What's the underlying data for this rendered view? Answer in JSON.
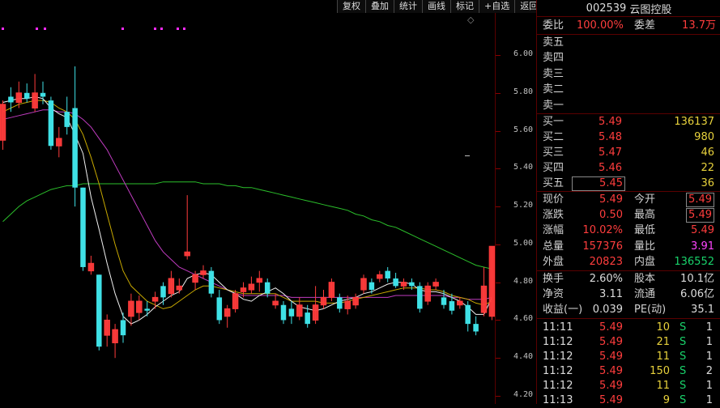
{
  "toolbar": {
    "buttons": [
      "复权",
      "叠加",
      "统计",
      "画线",
      "标记",
      "+自选",
      "返回"
    ]
  },
  "chart_data": {
    "type": "candlestick",
    "yticks": [
      "6.00",
      "5.80",
      "5.60",
      "5.40",
      "5.20",
      "5.00",
      "4.80",
      "4.60",
      "4.40",
      "4.20"
    ],
    "ylim": [
      4.2,
      6.0
    ],
    "candles": [
      {
        "o": 5.55,
        "c": 5.74,
        "h": 5.76,
        "l": 5.5
      },
      {
        "o": 5.78,
        "c": 5.75,
        "h": 5.83,
        "l": 5.7
      },
      {
        "o": 5.75,
        "c": 5.8,
        "h": 5.86,
        "l": 5.72
      },
      {
        "o": 5.8,
        "c": 5.77,
        "h": 5.85,
        "l": 5.75
      },
      {
        "o": 5.72,
        "c": 5.8,
        "h": 5.9,
        "l": 5.7
      },
      {
        "o": 5.8,
        "c": 5.78,
        "h": 5.86,
        "l": 5.74
      },
      {
        "o": 5.76,
        "c": 5.52,
        "h": 5.78,
        "l": 5.5
      },
      {
        "o": 5.52,
        "c": 5.56,
        "h": 5.62,
        "l": 5.46
      },
      {
        "o": 5.7,
        "c": 5.62,
        "h": 5.78,
        "l": 5.58
      },
      {
        "o": 5.72,
        "c": 5.3,
        "h": 5.94,
        "l": 5.2
      },
      {
        "o": 5.3,
        "c": 4.88,
        "h": 5.3,
        "l": 4.86
      },
      {
        "o": 4.86,
        "c": 4.9,
        "h": 4.94,
        "l": 4.84
      },
      {
        "o": 4.84,
        "c": 4.46,
        "h": 4.84,
        "l": 4.44
      },
      {
        "o": 4.52,
        "c": 4.6,
        "h": 4.63,
        "l": 4.46
      },
      {
        "o": 4.48,
        "c": 4.55,
        "h": 4.58,
        "l": 4.4
      },
      {
        "o": 4.6,
        "c": 4.52,
        "h": 4.64,
        "l": 4.48
      },
      {
        "o": 4.62,
        "c": 4.7,
        "h": 4.74,
        "l": 4.57
      },
      {
        "o": 4.64,
        "c": 4.7,
        "h": 4.73,
        "l": 4.6
      },
      {
        "o": 4.66,
        "c": 4.65,
        "h": 4.7,
        "l": 4.62
      },
      {
        "o": 4.7,
        "c": 4.72,
        "h": 4.75,
        "l": 4.66
      },
      {
        "o": 4.78,
        "c": 4.72,
        "h": 4.8,
        "l": 4.68
      },
      {
        "o": 4.74,
        "c": 4.82,
        "h": 4.86,
        "l": 4.72
      },
      {
        "o": 4.76,
        "c": 4.78,
        "h": 4.82,
        "l": 4.74
      },
      {
        "o": 4.94,
        "c": 4.96,
        "h": 5.26,
        "l": 4.92
      },
      {
        "o": 4.8,
        "c": 4.84,
        "h": 4.86,
        "l": 4.76
      },
      {
        "o": 4.84,
        "c": 4.86,
        "h": 4.89,
        "l": 4.82
      },
      {
        "o": 4.86,
        "c": 4.74,
        "h": 4.88,
        "l": 4.72
      },
      {
        "o": 4.72,
        "c": 4.6,
        "h": 4.76,
        "l": 4.58
      },
      {
        "o": 4.62,
        "c": 4.66,
        "h": 4.68,
        "l": 4.56
      },
      {
        "o": 4.66,
        "c": 4.74,
        "h": 4.76,
        "l": 4.64
      },
      {
        "o": 4.75,
        "c": 4.77,
        "h": 4.8,
        "l": 4.72
      },
      {
        "o": 4.76,
        "c": 4.79,
        "h": 4.83,
        "l": 4.74
      },
      {
        "o": 4.8,
        "c": 4.82,
        "h": 4.86,
        "l": 4.75
      },
      {
        "o": 4.8,
        "c": 4.74,
        "h": 4.82,
        "l": 4.72
      },
      {
        "o": 4.68,
        "c": 4.7,
        "h": 4.74,
        "l": 4.66
      },
      {
        "o": 4.68,
        "c": 4.6,
        "h": 4.7,
        "l": 4.58
      },
      {
        "o": 4.66,
        "c": 4.62,
        "h": 4.7,
        "l": 4.58
      },
      {
        "o": 4.62,
        "c": 4.68,
        "h": 4.72,
        "l": 4.6
      },
      {
        "o": 4.64,
        "c": 4.58,
        "h": 4.68,
        "l": 4.56
      },
      {
        "o": 4.6,
        "c": 4.68,
        "h": 4.78,
        "l": 4.58
      },
      {
        "o": 4.68,
        "c": 4.72,
        "h": 4.76,
        "l": 4.66
      },
      {
        "o": 4.72,
        "c": 4.8,
        "h": 4.82,
        "l": 4.7
      },
      {
        "o": 4.72,
        "c": 4.66,
        "h": 4.74,
        "l": 4.64
      },
      {
        "o": 4.66,
        "c": 4.7,
        "h": 4.73,
        "l": 4.63
      },
      {
        "o": 4.68,
        "c": 4.72,
        "h": 4.74,
        "l": 4.66
      },
      {
        "o": 4.76,
        "c": 4.82,
        "h": 4.84,
        "l": 4.74
      },
      {
        "o": 4.8,
        "c": 4.76,
        "h": 4.82,
        "l": 4.74
      },
      {
        "o": 4.82,
        "c": 4.84,
        "h": 4.86,
        "l": 4.8
      },
      {
        "o": 4.86,
        "c": 4.82,
        "h": 4.88,
        "l": 4.8
      },
      {
        "o": 4.82,
        "c": 4.78,
        "h": 4.85,
        "l": 4.77
      },
      {
        "o": 4.78,
        "c": 4.8,
        "h": 4.82,
        "l": 4.76
      },
      {
        "o": 4.8,
        "c": 4.78,
        "h": 4.82,
        "l": 4.76
      },
      {
        "o": 4.78,
        "c": 4.66,
        "h": 4.8,
        "l": 4.64
      },
      {
        "o": 4.7,
        "c": 4.78,
        "h": 4.8,
        "l": 4.68
      },
      {
        "o": 4.78,
        "c": 4.8,
        "h": 4.82,
        "l": 4.76
      },
      {
        "o": 4.72,
        "c": 4.68,
        "h": 4.76,
        "l": 4.66
      },
      {
        "o": 4.7,
        "c": 4.65,
        "h": 4.74,
        "l": 4.63
      },
      {
        "o": 4.68,
        "c": 4.7,
        "h": 4.72,
        "l": 4.66
      },
      {
        "o": 4.68,
        "c": 4.58,
        "h": 4.7,
        "l": 4.54
      },
      {
        "o": 4.58,
        "c": 4.54,
        "h": 4.62,
        "l": 4.52
      },
      {
        "o": 4.64,
        "c": 4.78,
        "h": 4.88,
        "l": 4.62
      },
      {
        "o": 4.62,
        "c": 4.99,
        "h": 4.99,
        "l": 4.6
      }
    ],
    "ma5": [
      5.75,
      5.76,
      5.77,
      5.77,
      5.78,
      5.77,
      5.72,
      5.69,
      5.67,
      5.58,
      5.48,
      5.25,
      5.08,
      4.9,
      4.74,
      4.62,
      4.58,
      4.6,
      4.63,
      4.67,
      4.7,
      4.73,
      4.75,
      4.82,
      4.84,
      4.85,
      4.84,
      4.8,
      4.76,
      4.74,
      4.71,
      4.7,
      4.73,
      4.75,
      4.77,
      4.74,
      4.7,
      4.67,
      4.66,
      4.65,
      4.66,
      4.68,
      4.7,
      4.71,
      4.72,
      4.74,
      4.75,
      4.77,
      4.79,
      4.8,
      4.8,
      4.79,
      4.76,
      4.75,
      4.75,
      4.74,
      4.72,
      4.7,
      4.67,
      4.63,
      4.63,
      4.72
    ],
    "ma10": [
      5.7,
      5.72,
      5.74,
      5.75,
      5.76,
      5.76,
      5.75,
      5.72,
      5.7,
      5.66,
      5.58,
      5.46,
      5.32,
      5.16,
      5.0,
      4.86,
      4.78,
      4.74,
      4.7,
      4.68,
      4.66,
      4.67,
      4.7,
      4.73,
      4.76,
      4.78,
      4.78,
      4.77,
      4.76,
      4.75,
      4.74,
      4.74,
      4.74,
      4.74,
      4.74,
      4.72,
      4.7,
      4.7,
      4.7,
      4.7,
      4.69,
      4.69,
      4.69,
      4.7,
      4.71,
      4.72,
      4.73,
      4.74,
      4.75,
      4.76,
      4.77,
      4.77,
      4.77,
      4.76,
      4.76,
      4.75,
      4.73,
      4.72,
      4.71,
      4.69,
      4.68,
      4.7
    ],
    "ma20": [
      5.66,
      5.67,
      5.68,
      5.69,
      5.7,
      5.71,
      5.71,
      5.7,
      5.7,
      5.69,
      5.66,
      5.62,
      5.56,
      5.5,
      5.42,
      5.34,
      5.26,
      5.18,
      5.1,
      5.02,
      4.96,
      4.92,
      4.88,
      4.86,
      4.84,
      4.82,
      4.8,
      4.78,
      4.76,
      4.74,
      4.73,
      4.73,
      4.73,
      4.73,
      4.73,
      4.73,
      4.72,
      4.72,
      4.72,
      4.72,
      4.72,
      4.72,
      4.72,
      4.72,
      4.72,
      4.72,
      4.72,
      4.72,
      4.72,
      4.73,
      4.73,
      4.73,
      4.73,
      4.73,
      4.73,
      4.73,
      4.72,
      4.72,
      4.71,
      4.71,
      4.71,
      4.72
    ],
    "ma60": [
      5.12,
      5.16,
      5.2,
      5.23,
      5.25,
      5.27,
      5.29,
      5.3,
      5.31,
      5.31,
      5.32,
      5.32,
      5.32,
      5.32,
      5.32,
      5.32,
      5.32,
      5.32,
      5.32,
      5.32,
      5.33,
      5.33,
      5.33,
      5.33,
      5.33,
      5.32,
      5.32,
      5.32,
      5.31,
      5.31,
      5.3,
      5.3,
      5.29,
      5.28,
      5.27,
      5.26,
      5.25,
      5.24,
      5.23,
      5.22,
      5.21,
      5.2,
      5.19,
      5.18,
      5.16,
      5.15,
      5.13,
      5.12,
      5.1,
      5.09,
      5.07,
      5.05,
      5.03,
      5.01,
      4.99,
      4.97,
      4.95,
      4.93,
      4.91,
      4.89,
      4.88,
      4.87
    ]
  },
  "quote": {
    "code": "002539",
    "name": "云图控股",
    "weibi_label": "委比",
    "weibi_value": "100.00%",
    "weicha_label": "委差",
    "weicha_value": "13.7万",
    "asks": [
      {
        "label": "卖五",
        "price": "",
        "vol": ""
      },
      {
        "label": "卖四",
        "price": "",
        "vol": ""
      },
      {
        "label": "卖三",
        "price": "",
        "vol": ""
      },
      {
        "label": "卖二",
        "price": "",
        "vol": ""
      },
      {
        "label": "卖一",
        "price": "",
        "vol": ""
      }
    ],
    "bids": [
      {
        "label": "买一",
        "price": "5.49",
        "vol": "136137"
      },
      {
        "label": "买二",
        "price": "5.48",
        "vol": "980"
      },
      {
        "label": "买三",
        "price": "5.47",
        "vol": "46"
      },
      {
        "label": "买四",
        "price": "5.46",
        "vol": "22"
      },
      {
        "label": "买五",
        "price": "5.45",
        "vol": "36"
      }
    ],
    "stats": [
      {
        "l1": "现价",
        "v1": "5.49",
        "l2": "今开",
        "v2": "5.49"
      },
      {
        "l1": "涨跌",
        "v1": "0.50",
        "l2": "最高",
        "v2": "5.49"
      },
      {
        "l1": "涨幅",
        "v1": "10.02%",
        "l2": "最低",
        "v2": "5.49"
      },
      {
        "l1": "总量",
        "v1": "157376",
        "l2": "量比",
        "v2": "3.91"
      },
      {
        "l1": "外盘",
        "v1": "20823",
        "l2": "内盘",
        "v2": "136552"
      }
    ],
    "stats2": [
      {
        "l1": "换手",
        "v1": "2.60%",
        "l2": "股本",
        "v2": "10.1亿"
      },
      {
        "l1": "净资",
        "v1": "3.11",
        "l2": "流通",
        "v2": "6.06亿"
      },
      {
        "l1": "收益(一)",
        "v1": "0.039",
        "l2": "PE(动)",
        "v2": "35.1"
      }
    ],
    "trades": [
      {
        "t": "11:11",
        "p": "5.49",
        "v": "10",
        "s": "S",
        "n": "1"
      },
      {
        "t": "11:12",
        "p": "5.49",
        "v": "21",
        "s": "S",
        "n": "1"
      },
      {
        "t": "11:12",
        "p": "5.49",
        "v": "11",
        "s": "S",
        "n": "1"
      },
      {
        "t": "11:12",
        "p": "5.49",
        "v": "150",
        "s": "S",
        "n": "2"
      },
      {
        "t": "11:12",
        "p": "5.49",
        "v": "11",
        "s": "S",
        "n": "1"
      },
      {
        "t": "11:13",
        "p": "5.49",
        "v": "9",
        "s": "S",
        "n": "1"
      }
    ]
  }
}
